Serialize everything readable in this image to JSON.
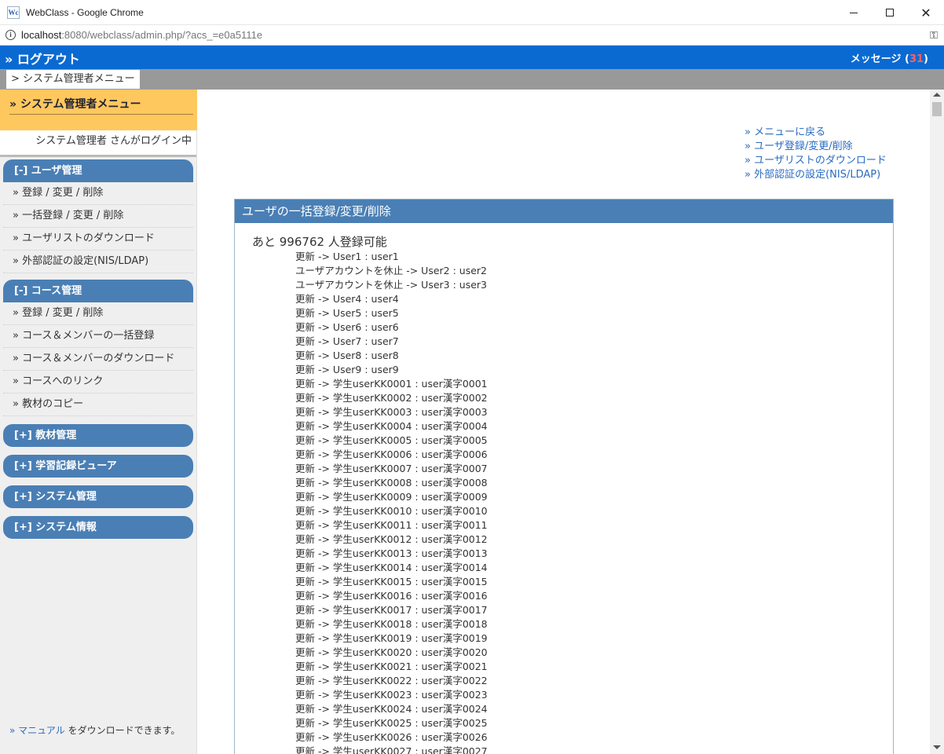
{
  "window": {
    "title": "WebClass - Google Chrome",
    "icon_text": "Wc",
    "min_label": "minimize",
    "url_host": "localhost",
    "url_rest": ":8080/webclass/admin.php/?acs_=e0a5111e"
  },
  "header": {
    "logout": "» ログアウト",
    "messages_label": "メッセージ (",
    "messages_count": "31",
    "messages_close": ")"
  },
  "breadcrumb": {
    "item": "> システム管理者メニュー"
  },
  "sidebar": {
    "title": "» システム管理者メニュー",
    "login_status": "システム管理者 さんがログイン中",
    "groups": [
      {
        "label": "[-] ユーザ管理",
        "items": [
          "» 登録 / 変更 / 削除",
          "» 一括登録 / 変更 / 削除",
          "» ユーザリストのダウンロード",
          "» 外部認証の設定(NIS/LDAP)"
        ]
      },
      {
        "label": "[-] コース管理",
        "items": [
          "» 登録 / 変更 / 削除",
          "» コース＆メンバーの一括登録",
          "» コース＆メンバーのダウンロード",
          "» コースへのリンク",
          "» 教材のコピー"
        ]
      },
      {
        "label": "[+] 教材管理"
      },
      {
        "label": "[+] 学習記録ビューア"
      },
      {
        "label": "[+] システム管理"
      },
      {
        "label": "[+] システム情報"
      }
    ],
    "manual_link": "» マニュアル",
    "manual_text": " をダウンロードできます。"
  },
  "main": {
    "links": [
      "» メニューに戻る",
      "» ユーザ登録/変更/削除",
      "» ユーザリストのダウンロード",
      "» 外部認証の設定(NIS/LDAP)"
    ],
    "panel_title": "ユーザの一括登録/変更/削除",
    "remaining": "あと 996762 人登録可能",
    "log": [
      "更新 -> User1 : user1",
      "ユーザアカウントを休止 -> User2 : user2",
      "ユーザアカウントを休止 -> User3 : user3",
      "更新 -> User4 : user4",
      "更新 -> User5 : user5",
      "更新 -> User6 : user6",
      "更新 -> User7 : user7",
      "更新 -> User8 : user8",
      "更新 -> User9 : user9",
      "更新 -> 学生userKK0001 : user漢字0001",
      "更新 -> 学生userKK0002 : user漢字0002",
      "更新 -> 学生userKK0003 : user漢字0003",
      "更新 -> 学生userKK0004 : user漢字0004",
      "更新 -> 学生userKK0005 : user漢字0005",
      "更新 -> 学生userKK0006 : user漢字0006",
      "更新 -> 学生userKK0007 : user漢字0007",
      "更新 -> 学生userKK0008 : user漢字0008",
      "更新 -> 学生userKK0009 : user漢字0009",
      "更新 -> 学生userKK0010 : user漢字0010",
      "更新 -> 学生userKK0011 : user漢字0011",
      "更新 -> 学生userKK0012 : user漢字0012",
      "更新 -> 学生userKK0013 : user漢字0013",
      "更新 -> 学生userKK0014 : user漢字0014",
      "更新 -> 学生userKK0015 : user漢字0015",
      "更新 -> 学生userKK0016 : user漢字0016",
      "更新 -> 学生userKK0017 : user漢字0017",
      "更新 -> 学生userKK0018 : user漢字0018",
      "更新 -> 学生userKK0019 : user漢字0019",
      "更新 -> 学生userKK0020 : user漢字0020",
      "更新 -> 学生userKK0021 : user漢字0021",
      "更新 -> 学生userKK0022 : user漢字0022",
      "更新 -> 学生userKK0023 : user漢字0023",
      "更新 -> 学生userKK0024 : user漢字0024",
      "更新 -> 学生userKK0025 : user漢字0025",
      "更新 -> 学生userKK0026 : user漢字0026",
      "更新 -> 学生userKK0027 : user漢字0027"
    ]
  },
  "colors": {
    "header_blue": "#0a6ad2",
    "panel_blue": "#4a7fb5",
    "sidebar_head": "#ffc85e",
    "message_count": "#ff6060",
    "link": "#2a6bc1"
  }
}
